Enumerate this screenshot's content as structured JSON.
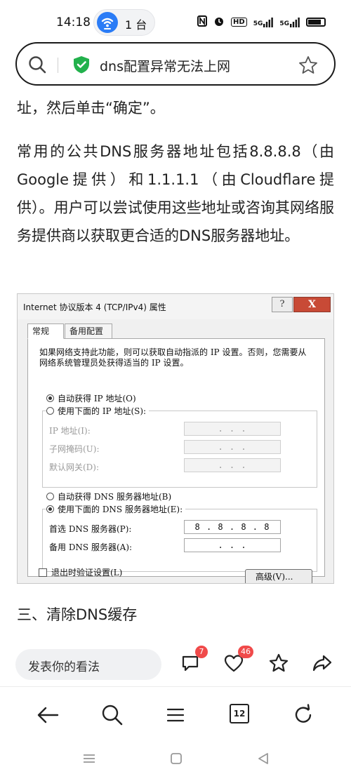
{
  "status_bar": {
    "time": "14:18",
    "hotspot_count": "1 台",
    "icons": [
      "nfc-icon",
      "alarm-icon",
      "hd-icon",
      "signal-5g-icon",
      "signal-5g-icon",
      "battery-icon"
    ],
    "network_label_1": "5G",
    "network_label_2": "5G",
    "hd_label": "HD"
  },
  "search": {
    "query": "dns配置异常无法上网"
  },
  "article": {
    "top_text": "址，然后单击“确定”。",
    "main_text": "常用的公共DNS服务器地址包括8.8.8.8（由Google提供）和1.1.1.1（由Cloudflare提供）。用户可以尝试使用这些地址或咨询其网络服务提供商以获取更合适的DNS服务器地址。",
    "section_heading": "三、清除DNS缓存"
  },
  "dialog": {
    "title": "Internet 协议版本 4 (TCP/IPv4) 属性",
    "help": "?",
    "close": "X",
    "tab_general": "常规",
    "tab_alternate": "备用配置",
    "description": "如果网络支持此功能，则可以获取自动指派的 IP 设置。否则，您需要从网络系统管理员处获得适当的 IP 设置。",
    "auto_ip": "自动获得 IP 地址(O)",
    "manual_ip": "使用下面的 IP 地址(S):",
    "ip_label": "IP 地址(I):",
    "mask_label": "子网掩码(U):",
    "gateway_label": "默认网关(D):",
    "empty_ip": ".   .   .",
    "auto_dns": "自动获得 DNS 服务器地址(B)",
    "manual_dns": "使用下面的 DNS 服务器地址(E):",
    "preferred_dns_label": "首选 DNS 服务器(P):",
    "preferred_dns_value": "8 . 8 . 8 . 8",
    "alternate_dns_label": "备用 DNS 服务器(A):",
    "alternate_dns_value": ".   .   .",
    "validate_label": "退出时验证设置(L)",
    "advanced_button": "高级(V)..."
  },
  "comment_bar": {
    "placeholder": "发表你的看法",
    "comment_count": "7",
    "like_count": "46"
  },
  "browser_nav": {
    "tab_count": "12"
  }
}
